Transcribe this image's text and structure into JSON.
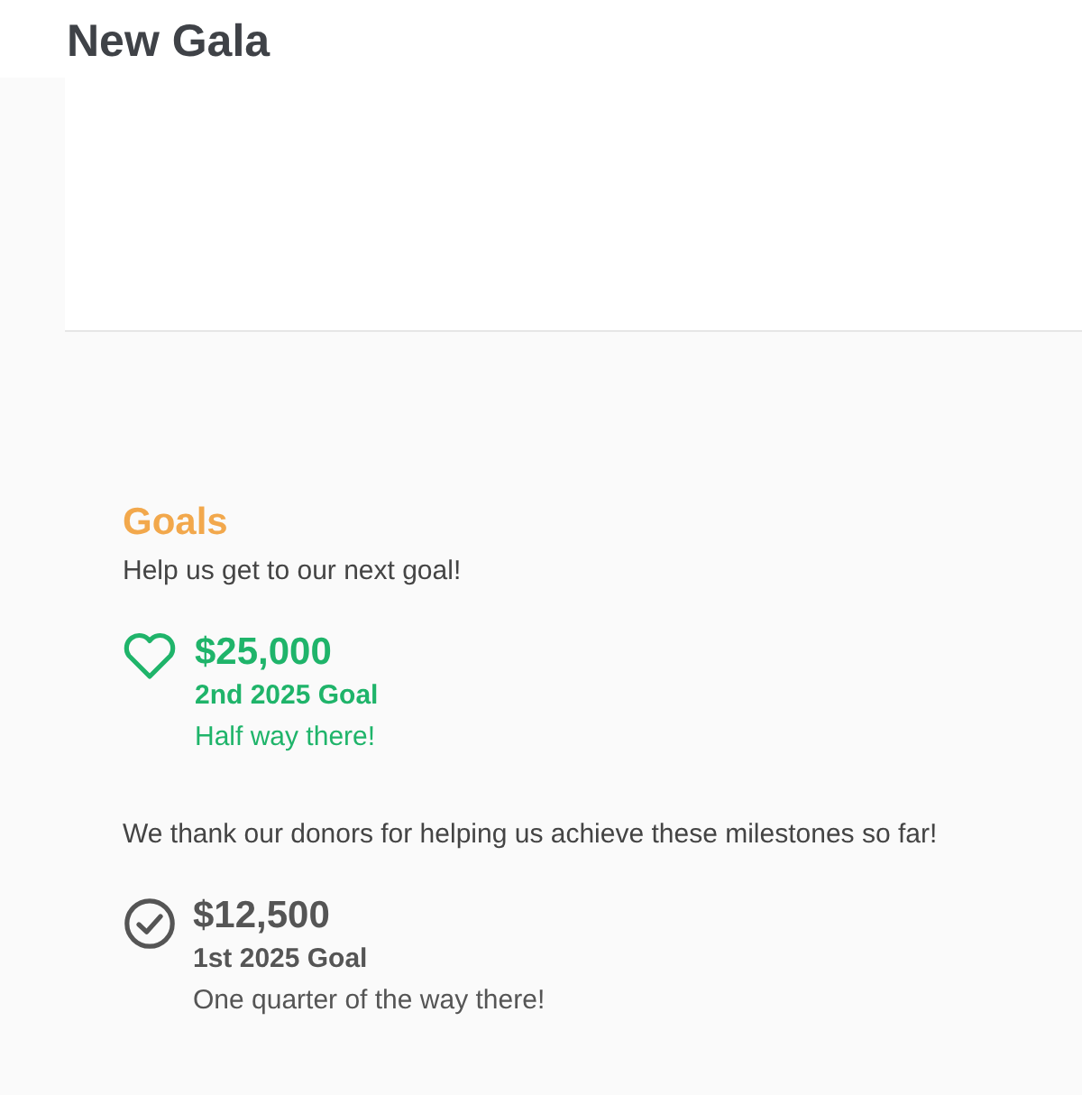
{
  "page": {
    "title": "New Gala"
  },
  "goals": {
    "heading": "Goals",
    "sections": [
      {
        "intro": "Help us get to our next goal!",
        "items": [
          {
            "kind": "in_progress",
            "amount": "$25,000",
            "name": "2nd 2025 Goal",
            "note": "Half way there!"
          }
        ]
      },
      {
        "intro": "We thank our donors for helping us achieve these milestones so far!",
        "items": [
          {
            "kind": "achieved",
            "amount": "$12,500",
            "name": "1st 2025 Goal",
            "note": "One quarter of the way there!"
          }
        ]
      }
    ]
  }
}
